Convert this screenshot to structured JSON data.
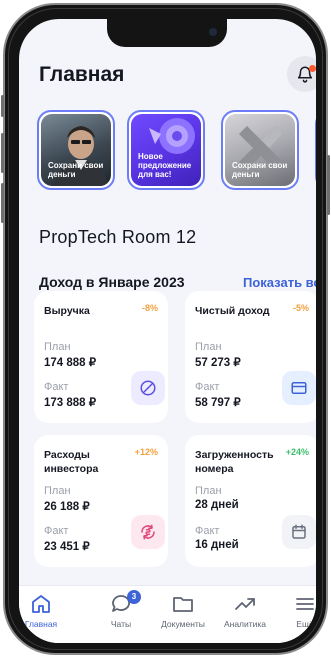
{
  "header": {
    "title": "Главная"
  },
  "stories": [
    {
      "text": "Сохрани свои деньги"
    },
    {
      "text": "Новое предложение для вас!"
    },
    {
      "text": "Сохрани свои деньги"
    }
  ],
  "room_title": "PropTech Room 12",
  "income": {
    "title": "Доход в Январе 2023",
    "show_all": "Показать все"
  },
  "cards": [
    {
      "title": "Выручка",
      "pct": "-8%",
      "plan_label": "План",
      "plan_value": "174 888 ₽",
      "fact_label": "Факт",
      "fact_value": "173 888 ₽",
      "icon": "pie-chart-icon"
    },
    {
      "title": "Чистый доход",
      "pct": "-5%",
      "plan_label": "План",
      "plan_value": "57  273 ₽",
      "fact_label": "Факт",
      "fact_value": "58 797 ₽",
      "icon": "credit-card-icon"
    },
    {
      "title": "Расходы инвестора",
      "pct": "+12%",
      "plan_label": "План",
      "plan_value": "26 188 ₽",
      "fact_label": "Факт",
      "fact_value": "23 451 ₽",
      "icon": "currency-exchange-icon"
    },
    {
      "title": "Загруженность номера",
      "pct": "+24%",
      "plan_label": "План",
      "plan_value": "28 дней",
      "fact_label": "Факт",
      "fact_value": "16 дней",
      "icon": "calendar-icon"
    }
  ],
  "tabs": [
    {
      "label": "Главная",
      "icon": "home-icon",
      "active": true
    },
    {
      "label": "Чаты",
      "icon": "chat-icon",
      "badge": "3"
    },
    {
      "label": "Документы",
      "icon": "folder-icon"
    },
    {
      "label": "Аналитика",
      "icon": "trend-icon"
    },
    {
      "label": "Ещё",
      "icon": "menu-icon"
    }
  ],
  "colors": {
    "accent": "#3d63d8",
    "negative": "#f2a03d",
    "positive": "#3bbf6a",
    "background": "#f3f5fa"
  }
}
